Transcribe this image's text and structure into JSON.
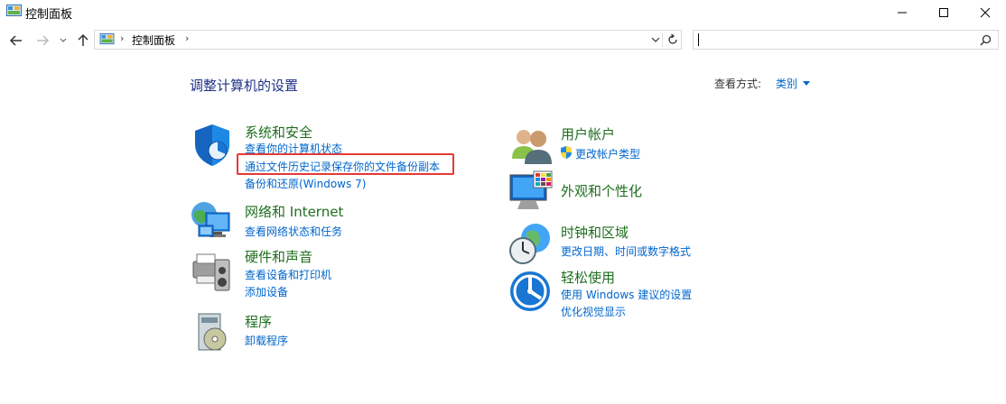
{
  "window": {
    "title": "控制面板"
  },
  "address": {
    "path": "控制面板",
    "sep1": "›",
    "sep2": "›"
  },
  "search": {
    "placeholder": ""
  },
  "main": {
    "title": "调整计算机的设置",
    "view_by_label": "查看方式:",
    "view_by_value": "类别"
  },
  "categories": [
    {
      "title": "系统和安全",
      "links": [
        "查看你的计算机状态",
        "通过文件历史记录保存你的文件备份副本",
        "备份和还原(Windows 7)"
      ]
    },
    {
      "title": "网络和 Internet",
      "links": [
        "查看网络状态和任务"
      ]
    },
    {
      "title": "硬件和声音",
      "links": [
        "查看设备和打印机",
        "添加设备"
      ]
    },
    {
      "title": "程序",
      "links": [
        "卸载程序"
      ]
    },
    {
      "title": "用户帐户",
      "links": [
        "更改帐户类型"
      ]
    },
    {
      "title": "外观和个性化",
      "links": []
    },
    {
      "title": "时钟和区域",
      "links": [
        "更改日期、时间或数字格式"
      ]
    },
    {
      "title": "轻松使用",
      "links": [
        "使用 Windows 建议的设置",
        "优化视觉显示"
      ]
    }
  ],
  "colors": {
    "accent": "#0066cc",
    "category_title": "#1e6e1e",
    "page_title": "#1e3287",
    "highlight": "#e53935"
  }
}
